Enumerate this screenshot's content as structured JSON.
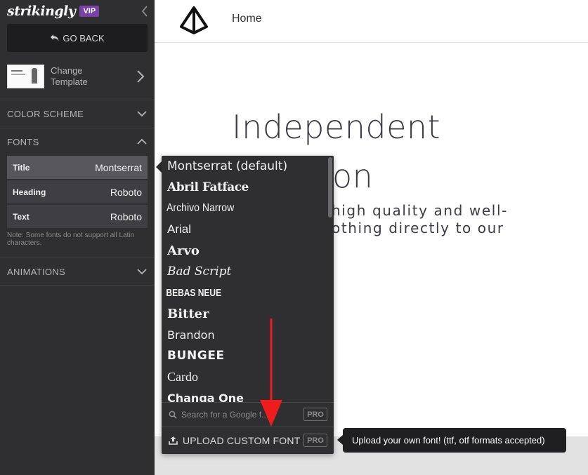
{
  "sidebar": {
    "brand": "strikingly",
    "vip_badge": "VIP",
    "go_back": "GO BACK",
    "template_label": "Change Template",
    "sections": {
      "color_scheme": "COLOR SCHEME",
      "fonts": "FONTS",
      "animations": "ANIMATIONS"
    },
    "font_rows": [
      {
        "label": "Title",
        "value": "Montserrat"
      },
      {
        "label": "Heading",
        "value": "Roboto"
      },
      {
        "label": "Text",
        "value": "Roboto"
      }
    ],
    "fonts_note": "Note: Some fonts do not support all Latin characters."
  },
  "preview": {
    "nav_home": "Home",
    "hero_title_line1": "Independent",
    "hero_title_line2": "on",
    "hero_sub_line1": "high quality and well-",
    "hero_sub_line2": "othing directly to our"
  },
  "dropdown": {
    "fonts": [
      "Montserrat (default)",
      "Abril Fatface",
      "Archivo Narrow",
      "Arial",
      "Arvo",
      "Bad Script",
      "BEBAS NEUE",
      "Bitter",
      "Brandon",
      "BUNGEE",
      "Cardo",
      "Changa One"
    ],
    "search_placeholder": "Search for a Google f...",
    "pro_label": "PRO",
    "upload_label": "UPLOAD CUSTOM FONT"
  },
  "tooltip": "Upload your own font! (ttf, otf formats accepted)",
  "colors": {
    "sidebar_bg": "#2f2f31",
    "vip_purple": "#7b3fa8",
    "annotation_red": "#ee1c1c"
  }
}
